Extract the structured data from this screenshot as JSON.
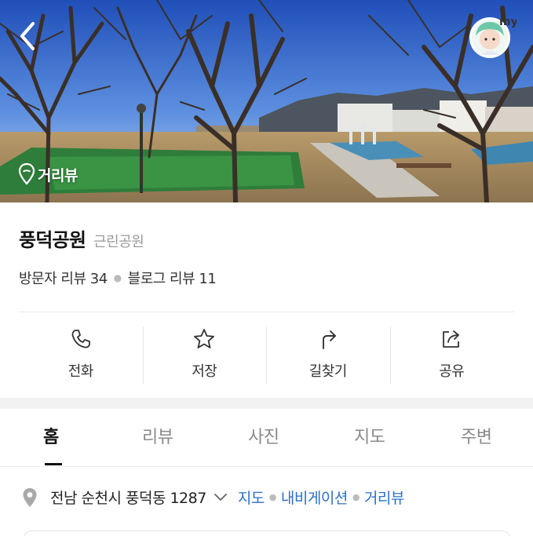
{
  "hero": {
    "street_view_label": "거리뷰",
    "avatar_text": "my"
  },
  "place": {
    "name": "풍덕공원",
    "category": "근린공원",
    "visitor_reviews": "방문자 리뷰 34",
    "blog_reviews": "블로그 리뷰 11"
  },
  "actions": [
    {
      "label": "전화",
      "icon": "phone-icon"
    },
    {
      "label": "저장",
      "icon": "star-icon"
    },
    {
      "label": "길찾기",
      "icon": "directions-icon"
    },
    {
      "label": "공유",
      "icon": "share-icon"
    }
  ],
  "tabs": [
    {
      "label": "홈",
      "active": true
    },
    {
      "label": "리뷰",
      "active": false
    },
    {
      "label": "사진",
      "active": false
    },
    {
      "label": "지도",
      "active": false
    },
    {
      "label": "주변",
      "active": false
    }
  ],
  "address": {
    "text": "전남 순천시 풍덕동 1287",
    "links": [
      "지도",
      "내비게이션",
      "거리뷰"
    ]
  },
  "colors": {
    "link": "#2c6fc9",
    "active_tab": "#111111",
    "inactive_tab": "#8a8a8a"
  }
}
